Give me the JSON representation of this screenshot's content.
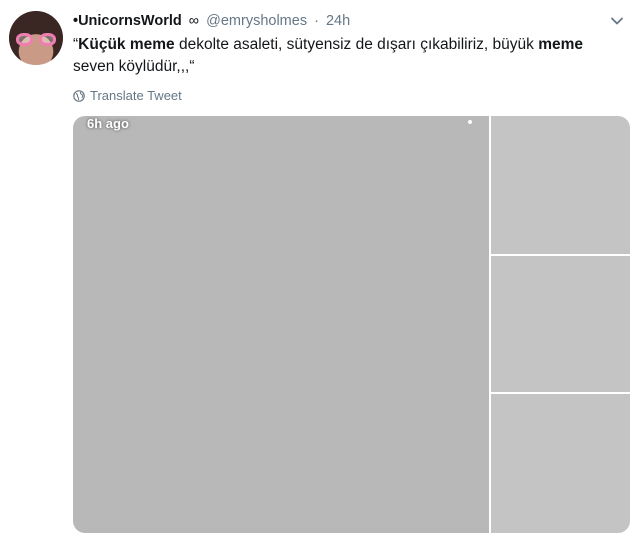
{
  "tweet": {
    "display_name": "•UnicornsWorld",
    "name_suffix": "∞",
    "handle": "@emrysholmes",
    "separator": "·",
    "time": "24h",
    "text_segments": [
      {
        "text": "“",
        "bold": false
      },
      {
        "text": "Küçük meme",
        "bold": true
      },
      {
        "text": " dekolte asaleti, sütyensiz de dışarı çıkabiliriz, büyük ",
        "bold": false
      },
      {
        "text": "meme",
        "bold": true
      },
      {
        "text": " seven köylüdür,,,“",
        "bold": false
      }
    ],
    "translate_label": "Translate Tweet"
  },
  "media": {
    "main_overlay_time": "6h ago",
    "thumb_count": 3
  },
  "icons": {
    "caret": "chevron-down-icon",
    "translate": "globe-icon"
  },
  "colors": {
    "text_primary": "#14171a",
    "text_secondary": "#657786",
    "background": "#ffffff"
  }
}
